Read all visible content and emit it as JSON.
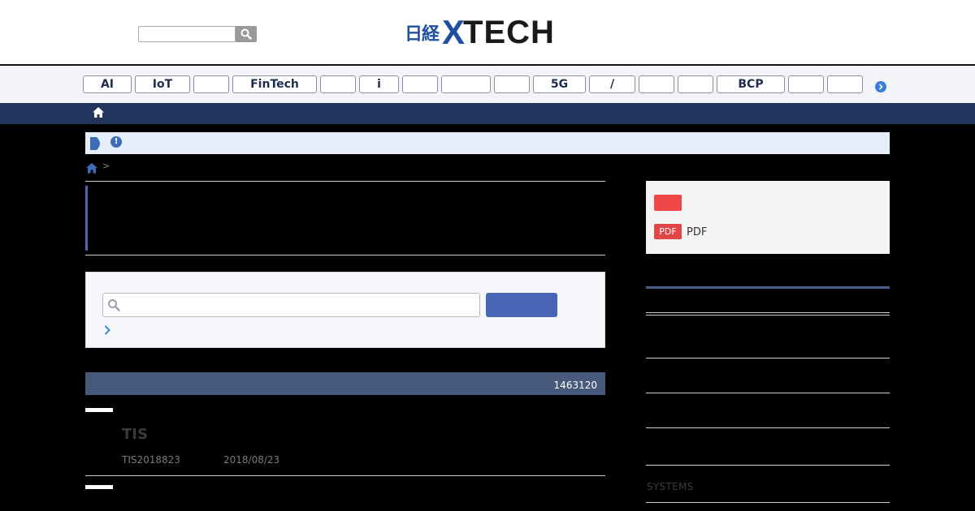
{
  "header": {
    "search": {
      "placeholder": ""
    },
    "logo": {
      "nikkei": "日経",
      "x": "X",
      "tech": "TECH"
    }
  },
  "tag_nav": {
    "tags": [
      {
        "label": "AI"
      },
      {
        "label": "IoT"
      },
      {
        "label": ""
      },
      {
        "label": "FinTech"
      },
      {
        "label": ""
      },
      {
        "label": "i"
      },
      {
        "label": ""
      },
      {
        "label": ""
      },
      {
        "label": ""
      },
      {
        "label": "5G"
      },
      {
        "label": "/"
      },
      {
        "label": ""
      },
      {
        "label": ""
      },
      {
        "label": "BCP"
      },
      {
        "label": ""
      },
      {
        "label": ""
      }
    ]
  },
  "notice": {
    "text": ""
  },
  "breadcrumb": {
    "separator": ">"
  },
  "results": {
    "count": "1463120",
    "items": [
      {
        "title": "TIS",
        "source": "TIS2018823",
        "date": "2018/08/23"
      }
    ]
  },
  "sidebar": {
    "pdf_badge": "PDF",
    "pdf_label": "PDF",
    "systems_label": "SYSTEMS"
  },
  "colors": {
    "brand_blue": "#1f4fa0",
    "nav_dark": "#22345c",
    "search_button": "#4766b4",
    "results_header": "#485a7b",
    "pdf_red": "#e14646"
  }
}
